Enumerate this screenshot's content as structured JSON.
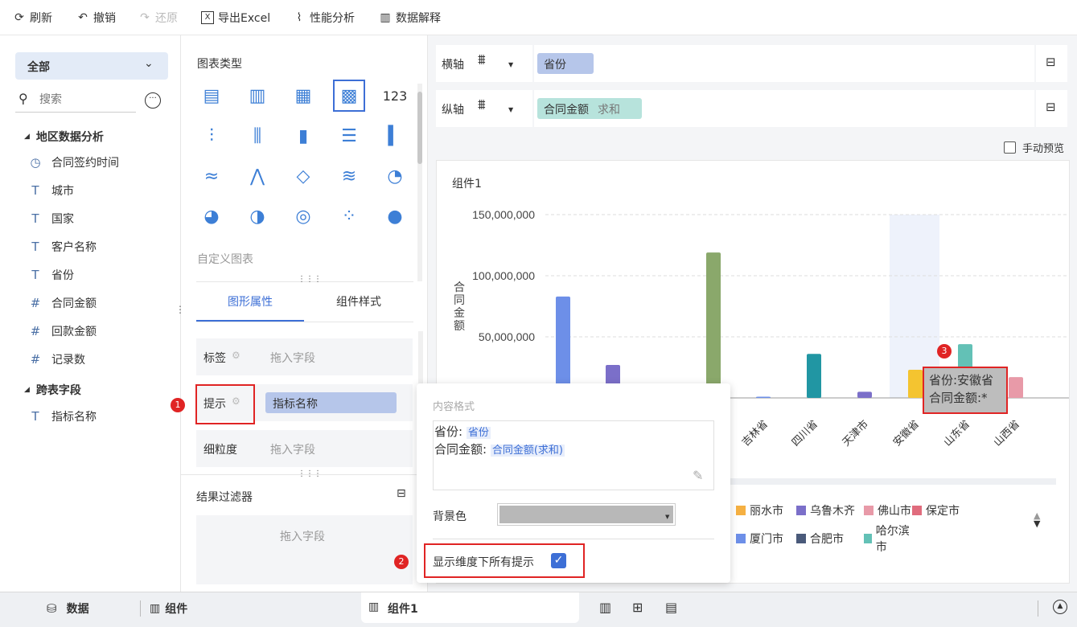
{
  "toolbar": {
    "refresh": "刷新",
    "undo": "撤销",
    "redo": "还原",
    "export": "导出Excel",
    "perf": "性能分析",
    "explain": "数据解释"
  },
  "left": {
    "dropdown": "全部",
    "search_placeholder": "搜索",
    "group1": "地区数据分析",
    "fields": [
      {
        "icon": "clock-icon",
        "glyph": "◷",
        "label": "合同签约时间"
      },
      {
        "icon": "text-icon",
        "glyph": "T",
        "label": "城市"
      },
      {
        "icon": "text-icon",
        "glyph": "T",
        "label": "国家"
      },
      {
        "icon": "text-icon",
        "glyph": "T",
        "label": "客户名称"
      },
      {
        "icon": "text-icon",
        "glyph": "T",
        "label": "省份"
      },
      {
        "icon": "number-icon",
        "glyph": "#",
        "label": "合同金额"
      },
      {
        "icon": "number-icon",
        "glyph": "#",
        "label": "回款金额"
      },
      {
        "icon": "count-icon",
        "glyph": "#",
        "label": "记录数"
      }
    ],
    "group2": "跨表字段",
    "cross_field": "指标名称"
  },
  "mid": {
    "chart_type_title": "图表类型",
    "custom_chart": "自定义图表",
    "tab_graph": "图形属性",
    "tab_style": "组件样式",
    "label_row": "标签",
    "tip_row": "提示",
    "grain_row": "细粒度",
    "drag_field": "拖入字段",
    "tip_value": "指标名称",
    "filter_title": "结果过滤器",
    "filter_drop": "拖入字段"
  },
  "axes": {
    "x_label": "横轴",
    "x_field": "省份",
    "y_label": "纵轴",
    "y_field": "合同金额",
    "y_agg": "求和",
    "manual_preview": "手动预览"
  },
  "chart_card": {
    "title": "组件1"
  },
  "chart_data": {
    "type": "bar",
    "ylabel": "合同金额",
    "ylim": [
      0,
      150000000
    ],
    "yticks": [
      "150,000,000",
      "100,000,000",
      "50,000,000",
      "0"
    ],
    "categories_visible": [
      "吉林省",
      "四川省",
      "天津市",
      "安徽省",
      "山东省",
      "山西省"
    ],
    "bars": [
      {
        "color": "#6d8fe8",
        "value": 83000000
      },
      {
        "color": "#7b6fc9",
        "value": 27000000
      },
      {
        "color": "#8aa86b",
        "value": 119000000
      },
      {
        "color": "#6d8fe8",
        "value": 1000000
      },
      {
        "color": "#2196a3",
        "value": 36000000
      },
      {
        "color": "#7b6fc9",
        "value": 5000000
      },
      {
        "color": "#f4c430",
        "value": 23000000
      },
      {
        "color": "#63c1b6",
        "value": 44000000
      },
      {
        "color": "#e89aa8",
        "value": 17000000
      }
    ],
    "tooltip": {
      "line1": "省份:安徽省",
      "line2": "合同金额:*"
    },
    "legend": [
      {
        "name": "丽水市",
        "color": "#f5b042"
      },
      {
        "name": "乌鲁木齐",
        "color": "#7b6fc9"
      },
      {
        "name": "佛山市",
        "color": "#e89aa8"
      },
      {
        "name": "保定市",
        "color": "#e06c7d"
      },
      {
        "name": "厦门市",
        "color": "#6d8fe8"
      },
      {
        "name": "合肥市",
        "color": "#4a5a7a"
      },
      {
        "name": "哈尔滨市",
        "color": "#63c1b6"
      }
    ]
  },
  "popup": {
    "title": "内容格式",
    "line1_label": "省份:",
    "line1_tag": "省份",
    "line2_label": "合同金额:",
    "line2_tag": "合同金额(求和)",
    "bg_label": "背景色",
    "show_all": "显示维度下所有提示"
  },
  "badges": [
    "1",
    "2",
    "3"
  ],
  "bottom": {
    "data": "数据",
    "component_tab": "组件",
    "active_tab": "组件1"
  }
}
